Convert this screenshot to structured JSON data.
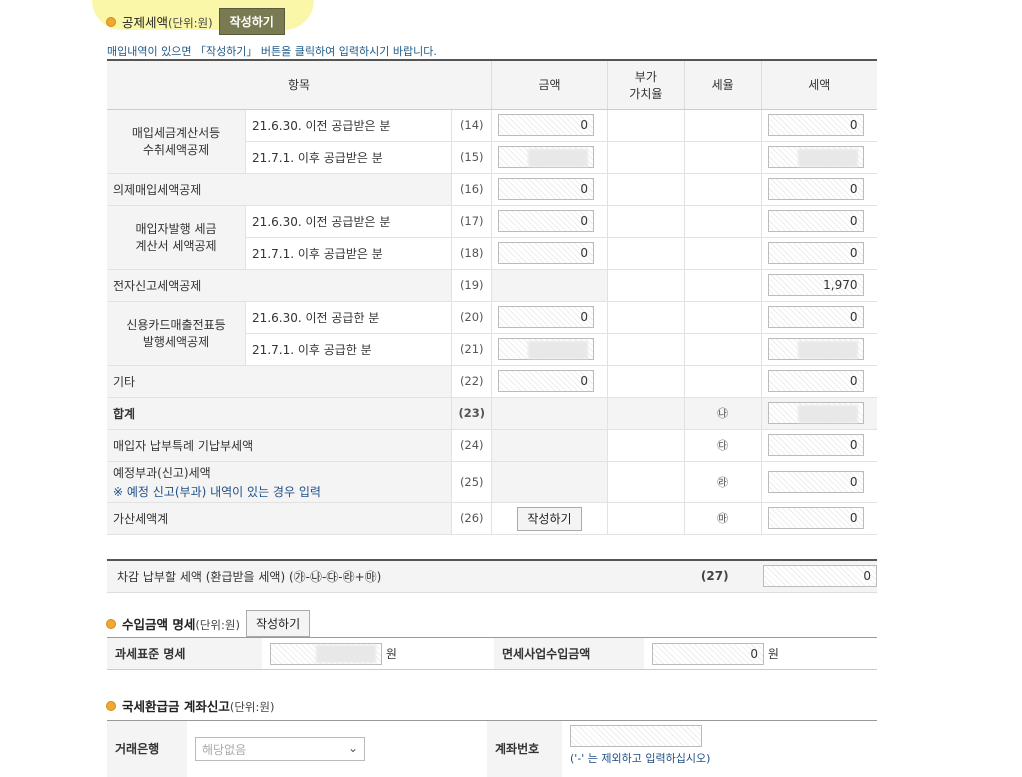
{
  "deduction": {
    "title": "공제세액",
    "unit": "(단위:원)",
    "write_label": "작성하기",
    "notice": "매입내역이 있으면 「작성하기」 버튼을 클릭하여 입력하시기 바랍니다.",
    "headers": {
      "item": "항목",
      "amount": "금액",
      "vat_rate_a": "부가",
      "vat_rate_b": "가치율",
      "rate": "세율",
      "tax": "세액"
    },
    "rows": {
      "r1_group": "매입세금계산서등",
      "r1_group2": "수취세액공제",
      "r14_label": "21.6.30. 이전 공급받은 분",
      "r14_num": "(14)",
      "r14_amount": "0",
      "r14_tax": "0",
      "r15_label": "21.7.1. 이후 공급받은 분",
      "r15_num": "(15)",
      "r16_label": "의제매입세액공제",
      "r16_num": "(16)",
      "r16_amount": "0",
      "r16_tax": "0",
      "r2_group": "매입자발행 세금",
      "r2_group2": "계산서 세액공제",
      "r17_label": "21.6.30. 이전 공급받은 분",
      "r17_num": "(17)",
      "r17_amount": "0",
      "r17_tax": "0",
      "r18_label": "21.7.1. 이후 공급받은 분",
      "r18_num": "(18)",
      "r18_amount": "0",
      "r18_tax": "0",
      "r19_label": "전자신고세액공제",
      "r19_num": "(19)",
      "r19_tax": "1,970",
      "r3_group": "신용카드매출전표등",
      "r3_group2": "발행세액공제",
      "r20_label": "21.6.30. 이전 공급한 분",
      "r20_num": "(20)",
      "r20_amount": "0",
      "r20_tax": "0",
      "r21_label": "21.7.1. 이후 공급한 분",
      "r21_num": "(21)",
      "r22_label": "기타",
      "r22_num": "(22)",
      "r22_amount": "0",
      "r22_tax": "0",
      "r23_label": "합계",
      "r23_num": "(23)",
      "r23_circ": "㉯",
      "r24_label": "매입자 납부특례 기납부세액",
      "r24_num": "(24)",
      "r24_circ": "㉰",
      "r24_tax": "0",
      "r25_label": "예정부과(신고)세액",
      "r25_sub": "※ 예정 신고(부과) 내역이 있는 경우 입력",
      "r25_num": "(25)",
      "r25_circ": "㉱",
      "r25_tax": "0",
      "r26_label": "가산세액계",
      "r26_num": "(26)",
      "r26_btn": "작성하기",
      "r26_circ": "㉲",
      "r26_tax": "0"
    },
    "total": {
      "label": "차감 납부할 세액 (환급받을 세액) (㉮-㉯-㉰-㉱+㉲)",
      "num": "(27)",
      "value": "0"
    }
  },
  "income": {
    "title": "수입금액 명세",
    "unit": "(단위:원)",
    "write_label": "작성하기",
    "taxable_label": "과세표준 명세",
    "won": "원",
    "exempt_label": "면세사업수입금액",
    "exempt_value": "0"
  },
  "refund": {
    "title": "국세환급금 계좌신고",
    "unit": "(단위:원)",
    "bank_label": "거래은행",
    "bank_value": "해당없음",
    "account_label": "계좌번호",
    "hint": "('-' 는 제외하고 입력하십시오)"
  }
}
